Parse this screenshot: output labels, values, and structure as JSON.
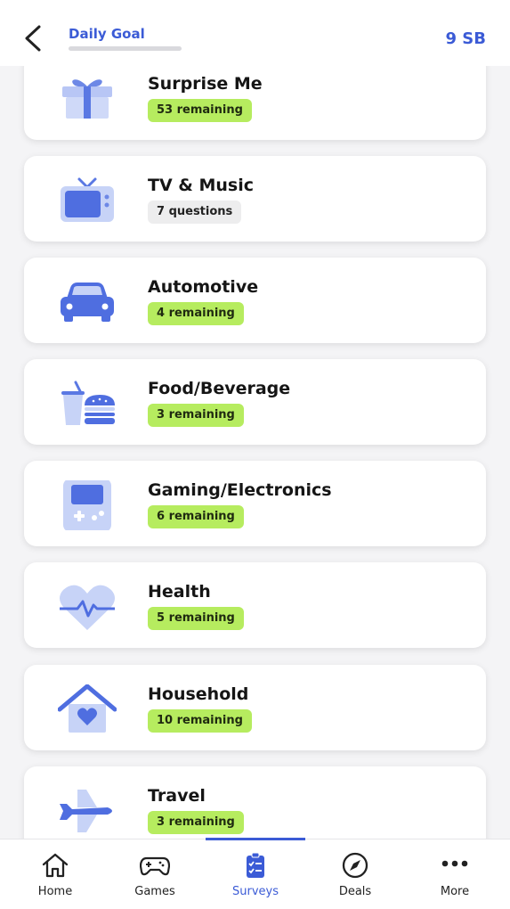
{
  "header": {
    "goal_label": "Daily Goal",
    "goal_progress": 0,
    "balance": "9 SB"
  },
  "categories": [
    {
      "title": "Surprise Me",
      "badge": "53 remaining",
      "icon": "gift-icon"
    },
    {
      "title": "TV & Music",
      "badge": "7 questions",
      "icon": "tv-icon"
    },
    {
      "title": "Automotive",
      "badge": "4 remaining",
      "icon": "car-icon"
    },
    {
      "title": "Food/Beverage",
      "badge": "3 remaining",
      "icon": "food-icon"
    },
    {
      "title": "Gaming/Electronics",
      "badge": "6 remaining",
      "icon": "gameboy-icon"
    },
    {
      "title": "Health",
      "badge": "5 remaining",
      "icon": "heart-pulse-icon"
    },
    {
      "title": "Household",
      "badge": "10 remaining",
      "icon": "house-heart-icon"
    },
    {
      "title": "Travel",
      "badge": "3 remaining",
      "icon": "airplane-icon"
    }
  ],
  "nav": [
    {
      "label": "Home",
      "icon": "home-icon"
    },
    {
      "label": "Games",
      "icon": "gamepad-icon"
    },
    {
      "label": "Surveys",
      "icon": "clipboard-check-icon",
      "active": true
    },
    {
      "label": "Deals",
      "icon": "compass-icon"
    },
    {
      "label": "More",
      "icon": "more-dots-icon"
    }
  ],
  "colors": {
    "accent": "#3b5bd6",
    "badge_green": "#b6ec5f",
    "badge_grey": "#ededee",
    "icon_blue": "#4f6ee0",
    "icon_light": "#c9d4f7"
  }
}
